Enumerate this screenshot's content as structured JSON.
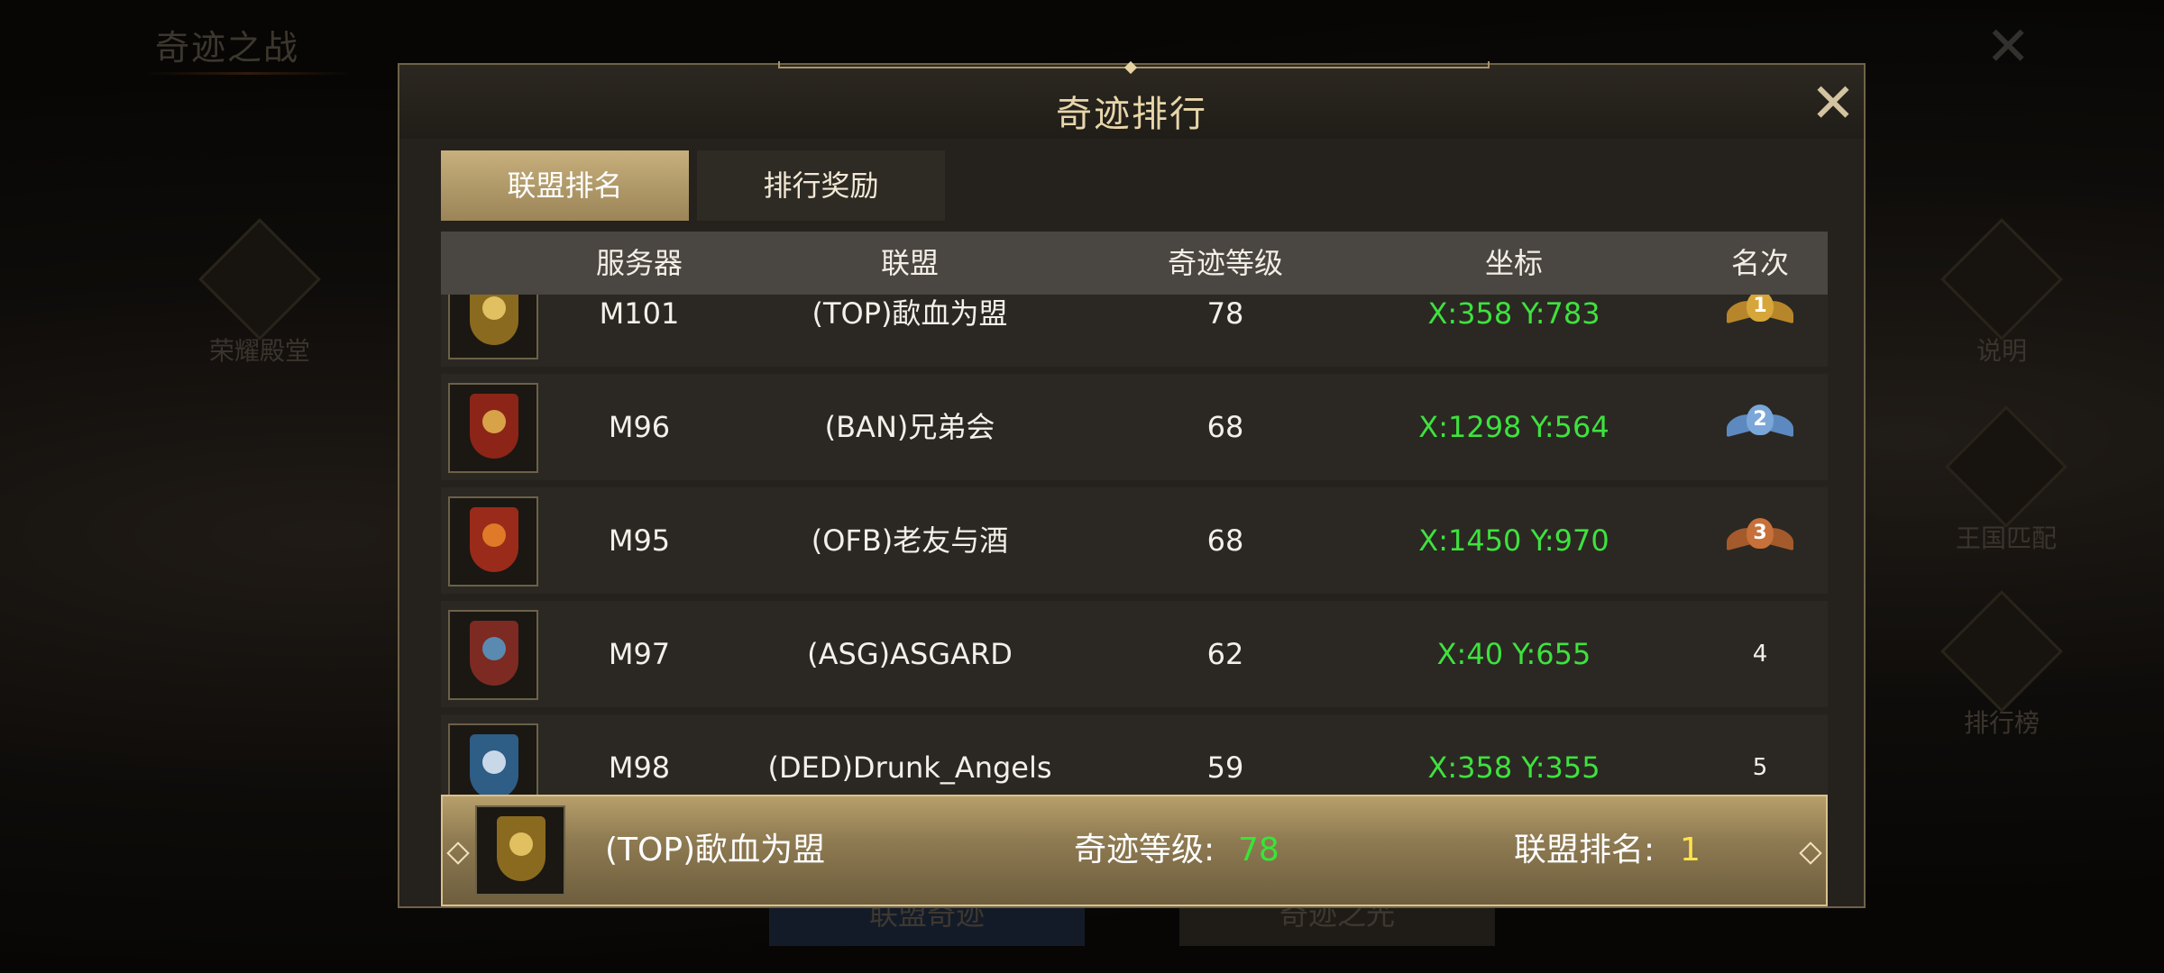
{
  "background": {
    "title": "奇迹之战",
    "side_left": {
      "label": "荣耀殿堂"
    },
    "side_right": [
      {
        "label": "说明"
      },
      {
        "label": "王国匹配"
      },
      {
        "label": "排行榜"
      }
    ],
    "bottom_buttons": [
      {
        "label": "联盟奇迹"
      },
      {
        "label": "奇迹之光"
      }
    ]
  },
  "panel": {
    "title": "奇迹排行",
    "tabs": [
      {
        "label": "联盟排名",
        "active": true
      },
      {
        "label": "排行奖励",
        "active": false
      }
    ],
    "columns": [
      "服务器",
      "联盟",
      "奇迹等级",
      "坐标",
      "名次"
    ],
    "rows": [
      {
        "server": "M101",
        "alliance": "(TOP)歃血为盟",
        "level": "78",
        "coords": "X:358 Y:783",
        "rank": "1",
        "medal": "gold",
        "crest_color": "#8a6a1e"
      },
      {
        "server": "M96",
        "alliance": "(BAN)兄弟会",
        "level": "68",
        "coords": "X:1298 Y:564",
        "rank": "2",
        "medal": "silver",
        "crest_color": "#8c2418"
      },
      {
        "server": "M95",
        "alliance": "(OFB)老友与酒",
        "level": "68",
        "coords": "X:1450 Y:970",
        "rank": "3",
        "medal": "bronze",
        "crest_color": "#9a2a1a"
      },
      {
        "server": "M97",
        "alliance": "(ASG)ASGARD",
        "level": "62",
        "coords": "X:40 Y:655",
        "rank": "4",
        "medal": "",
        "crest_color": "#7d2a22"
      },
      {
        "server": "M98",
        "alliance": "(DED)Drunk_Angels",
        "level": "59",
        "coords": "X:358 Y:355",
        "rank": "5",
        "medal": "",
        "crest_color": "#2e5d86"
      }
    ],
    "footer": {
      "alliance": "(TOP)歃血为盟",
      "level_label": "奇迹等级:",
      "level_value": "78",
      "rank_label": "联盟排名:",
      "rank_value": "1"
    }
  },
  "colors": {
    "coords": "#3ee23e",
    "gold": "#d6a63a",
    "silver": "#7aa7d8",
    "bronze": "#c7703a",
    "rank_value": "#ffe34a"
  }
}
